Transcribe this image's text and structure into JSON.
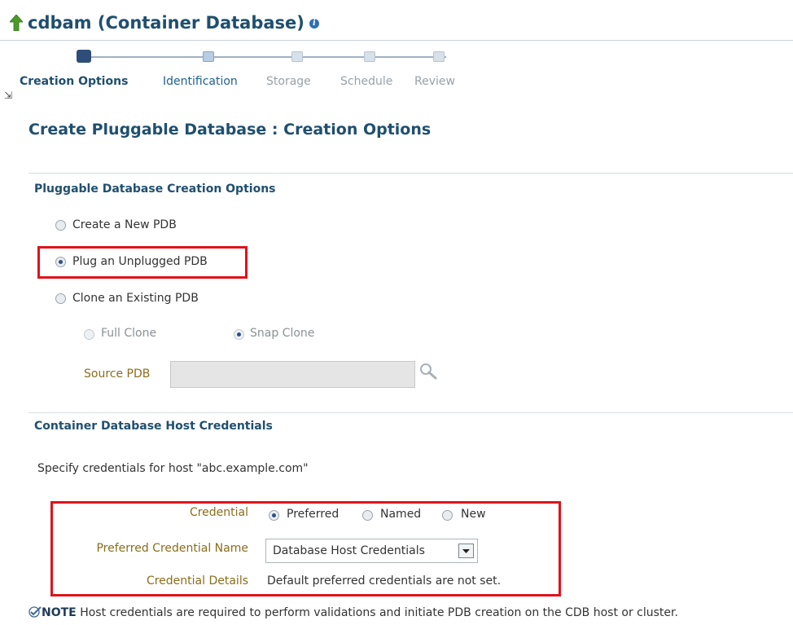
{
  "header": {
    "title": "cdbam (Container Database)",
    "up_icon": "up-arrow-icon",
    "info_icon": "info-icon"
  },
  "train": {
    "steps": [
      {
        "label": "Creation Options",
        "state": "active"
      },
      {
        "label": "Identification",
        "state": "next"
      },
      {
        "label": "Storage",
        "state": "disabled"
      },
      {
        "label": "Schedule",
        "state": "disabled"
      },
      {
        "label": "Review",
        "state": "disabled"
      }
    ]
  },
  "page": {
    "title": "Create Pluggable Database : Creation Options"
  },
  "creation_options": {
    "section_title": "Pluggable Database Creation Options",
    "create_new": "Create a New PDB",
    "plug_unplugged": "Plug an Unplugged PDB",
    "clone_existing": "Clone an Existing PDB",
    "full_clone": "Full Clone",
    "snap_clone": "Snap Clone",
    "source_pdb_label": "Source PDB",
    "source_pdb_value": "",
    "selected": "Plug an Unplugged PDB"
  },
  "credentials": {
    "section_title": "Container Database Host Credentials",
    "instruction": "Specify credentials for host \"abc.example.com\"",
    "credential_label": "Credential",
    "opt_preferred": "Preferred",
    "opt_named": "Named",
    "opt_new": "New",
    "selected": "Preferred",
    "pref_name_label": "Preferred Credential Name",
    "pref_name_value": "Database Host Credentials",
    "details_label": "Credential Details",
    "details_value": "Default preferred credentials are not set."
  },
  "note": {
    "prefix": "NOTE",
    "text": "Host credentials are required to perform validations and initiate PDB creation on the CDB host or cluster."
  },
  "colors": {
    "heading": "#1f4f6f",
    "highlight_box": "#e0131b",
    "label_gold": "#8a6d1b"
  }
}
